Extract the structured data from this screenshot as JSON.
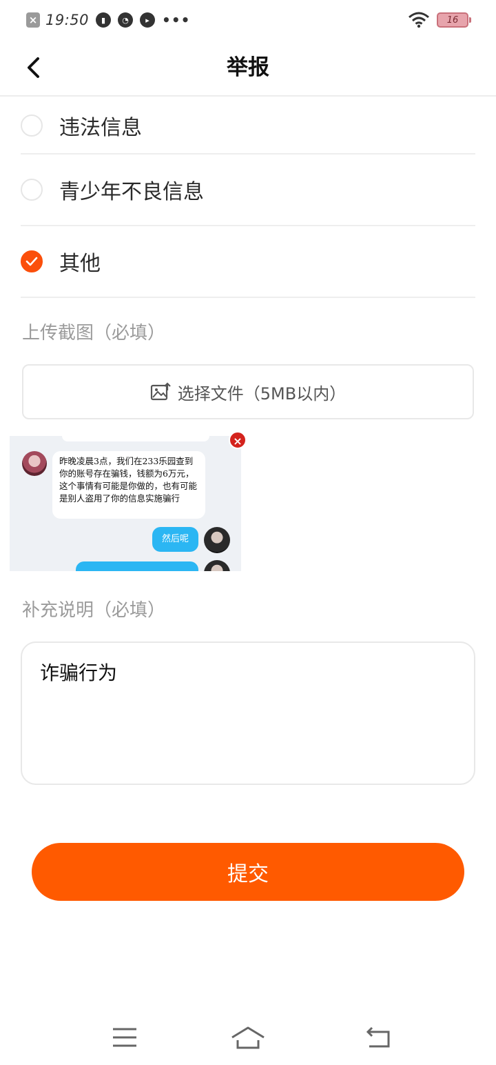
{
  "status_bar": {
    "time": "19:50",
    "more": "•••",
    "battery": "16",
    "icons": [
      "close-notification-icon",
      "voice-icon",
      "speed-icon",
      "chat-icon",
      "wifi-icon",
      "battery-icon"
    ]
  },
  "nav": {
    "title": "举报",
    "back_icon": "chevron-left-icon"
  },
  "options": [
    {
      "label": "违法信息",
      "checked": false
    },
    {
      "label": "青少年不良信息",
      "checked": false
    },
    {
      "label": "其他",
      "checked": true
    }
  ],
  "upload": {
    "label": "上传截图（必填）",
    "button_label": "选择文件（5MB以内）",
    "icon": "image-upload-icon",
    "thumbnail": {
      "message_left": "昨晚凌晨3点，我们在233乐园查到你的账号存在骗钱，钱额为6万元，这个事情有可能是你做的，也有可能是别人盗用了你的信息实施骗行",
      "message_right": "然后呢"
    }
  },
  "description": {
    "label": "补充说明（必填）",
    "value": "诈骗行为"
  },
  "submit_label": "提交",
  "colors": {
    "accent": "#ff5a00",
    "radio_checked": "#fb4f0b",
    "remove": "#d4231d"
  }
}
